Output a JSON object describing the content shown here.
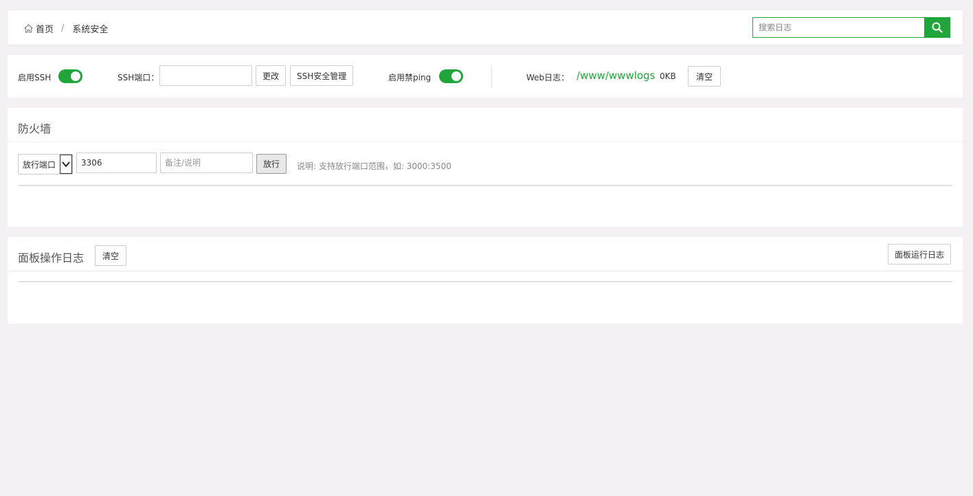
{
  "breadcrumb": {
    "home": "首页",
    "separator": "/",
    "current": "系统安全"
  },
  "search": {
    "placeholder": "搜索日志",
    "value": "",
    "icon": "search-icon"
  },
  "settings": {
    "ssh_label": "启用SSH",
    "ssh_enabled": true,
    "ssh_port_label": "SSH端口：",
    "ssh_port_value": "",
    "change_button": "更改",
    "ssh_manage_button": "SSH安全管理",
    "ping_label": "启用禁ping",
    "ping_enabled": true,
    "web_log_label": "Web日志：",
    "web_log_path": "/www/wwwlogs",
    "web_log_size": "0KB",
    "clear_button": "清空"
  },
  "firewall": {
    "title": "防火墙",
    "select_value": "放行端口",
    "port_value": "3306",
    "remark_placeholder": "备注/说明",
    "allow_button": "放行",
    "note": "说明: 支持放行端口范围，如: 3000:3500"
  },
  "panel_log": {
    "title": "面板操作日志",
    "clear_button": "清空",
    "run_log_button": "面板运行日志"
  },
  "colors": {
    "accent": "#20a53a",
    "page_bg": "#f4f0f3"
  }
}
